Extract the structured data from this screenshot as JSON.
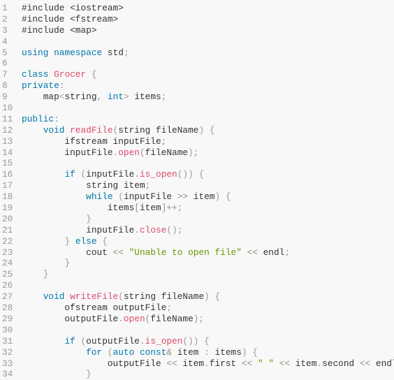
{
  "editor": {
    "language": "cpp",
    "colors": {
      "background": "#f8f8f8",
      "line_number": "#999999",
      "text": "#333333",
      "keyword": "#0077aa",
      "function": "#dd4a68",
      "string": "#669900",
      "punctuation": "#999999"
    },
    "lines": [
      {
        "n": "1",
        "tokens": [
          [
            "plain",
            "#include <iostream>"
          ]
        ]
      },
      {
        "n": "2",
        "tokens": [
          [
            "plain",
            "#include <fstream>"
          ]
        ]
      },
      {
        "n": "3",
        "tokens": [
          [
            "plain",
            "#include <map>"
          ]
        ]
      },
      {
        "n": "4",
        "tokens": []
      },
      {
        "n": "5",
        "tokens": [
          [
            "kw",
            "using"
          ],
          [
            "plain",
            " "
          ],
          [
            "kw",
            "namespace"
          ],
          [
            "plain",
            " std"
          ],
          [
            "punc",
            ";"
          ]
        ]
      },
      {
        "n": "6",
        "tokens": []
      },
      {
        "n": "7",
        "tokens": [
          [
            "kw",
            "class"
          ],
          [
            "plain",
            " "
          ],
          [
            "cls",
            "Grocer"
          ],
          [
            "plain",
            " "
          ],
          [
            "punc",
            "{"
          ]
        ]
      },
      {
        "n": "8",
        "tokens": [
          [
            "kw",
            "private"
          ],
          [
            "punc",
            ":"
          ]
        ]
      },
      {
        "n": "9",
        "tokens": [
          [
            "plain",
            "    map"
          ],
          [
            "punc",
            "<"
          ],
          [
            "plain",
            "string"
          ],
          [
            "punc",
            ","
          ],
          [
            "plain",
            " "
          ],
          [
            "kw",
            "int"
          ],
          [
            "punc",
            ">"
          ],
          [
            "plain",
            " items"
          ],
          [
            "punc",
            ";"
          ]
        ]
      },
      {
        "n": "10",
        "tokens": []
      },
      {
        "n": "11",
        "tokens": [
          [
            "kw",
            "public"
          ],
          [
            "punc",
            ":"
          ]
        ]
      },
      {
        "n": "12",
        "tokens": [
          [
            "plain",
            "    "
          ],
          [
            "kw",
            "void"
          ],
          [
            "plain",
            " "
          ],
          [
            "fn",
            "readFile"
          ],
          [
            "punc",
            "("
          ],
          [
            "plain",
            "string fileName"
          ],
          [
            "punc",
            ")"
          ],
          [
            "plain",
            " "
          ],
          [
            "punc",
            "{"
          ]
        ]
      },
      {
        "n": "13",
        "tokens": [
          [
            "plain",
            "        ifstream inputFile"
          ],
          [
            "punc",
            ";"
          ]
        ]
      },
      {
        "n": "14",
        "tokens": [
          [
            "plain",
            "        inputFile"
          ],
          [
            "punc",
            "."
          ],
          [
            "fn",
            "open"
          ],
          [
            "punc",
            "("
          ],
          [
            "plain",
            "fileName"
          ],
          [
            "punc",
            ")"
          ],
          [
            "punc",
            ";"
          ]
        ]
      },
      {
        "n": "15",
        "tokens": []
      },
      {
        "n": "16",
        "tokens": [
          [
            "plain",
            "        "
          ],
          [
            "kw",
            "if"
          ],
          [
            "plain",
            " "
          ],
          [
            "punc",
            "("
          ],
          [
            "plain",
            "inputFile"
          ],
          [
            "punc",
            "."
          ],
          [
            "fn",
            "is_open"
          ],
          [
            "punc",
            "("
          ],
          [
            "punc",
            ")"
          ],
          [
            "punc",
            ")"
          ],
          [
            "plain",
            " "
          ],
          [
            "punc",
            "{"
          ]
        ]
      },
      {
        "n": "17",
        "tokens": [
          [
            "plain",
            "            string item"
          ],
          [
            "punc",
            ";"
          ]
        ]
      },
      {
        "n": "18",
        "tokens": [
          [
            "plain",
            "            "
          ],
          [
            "kw",
            "while"
          ],
          [
            "plain",
            " "
          ],
          [
            "punc",
            "("
          ],
          [
            "plain",
            "inputFile "
          ],
          [
            "op",
            ">>"
          ],
          [
            "plain",
            " item"
          ],
          [
            "punc",
            ")"
          ],
          [
            "plain",
            " "
          ],
          [
            "punc",
            "{"
          ]
        ]
      },
      {
        "n": "19",
        "tokens": [
          [
            "plain",
            "                items"
          ],
          [
            "punc",
            "["
          ],
          [
            "plain",
            "item"
          ],
          [
            "punc",
            "]"
          ],
          [
            "op",
            "++"
          ],
          [
            "punc",
            ";"
          ]
        ]
      },
      {
        "n": "20",
        "tokens": [
          [
            "plain",
            "            "
          ],
          [
            "punc",
            "}"
          ]
        ]
      },
      {
        "n": "21",
        "tokens": [
          [
            "plain",
            "            inputFile"
          ],
          [
            "punc",
            "."
          ],
          [
            "fn",
            "close"
          ],
          [
            "punc",
            "("
          ],
          [
            "punc",
            ")"
          ],
          [
            "punc",
            ";"
          ]
        ]
      },
      {
        "n": "22",
        "tokens": [
          [
            "plain",
            "        "
          ],
          [
            "punc",
            "}"
          ],
          [
            "plain",
            " "
          ],
          [
            "kw",
            "else"
          ],
          [
            "plain",
            " "
          ],
          [
            "punc",
            "{"
          ]
        ]
      },
      {
        "n": "23",
        "tokens": [
          [
            "plain",
            "            cout "
          ],
          [
            "op",
            "<<"
          ],
          [
            "plain",
            " "
          ],
          [
            "str",
            "\"Unable to open file\""
          ],
          [
            "plain",
            " "
          ],
          [
            "op",
            "<<"
          ],
          [
            "plain",
            " endl"
          ],
          [
            "punc",
            ";"
          ]
        ]
      },
      {
        "n": "24",
        "tokens": [
          [
            "plain",
            "        "
          ],
          [
            "punc",
            "}"
          ]
        ]
      },
      {
        "n": "25",
        "tokens": [
          [
            "plain",
            "    "
          ],
          [
            "punc",
            "}"
          ]
        ]
      },
      {
        "n": "26",
        "tokens": []
      },
      {
        "n": "27",
        "tokens": [
          [
            "plain",
            "    "
          ],
          [
            "kw",
            "void"
          ],
          [
            "plain",
            " "
          ],
          [
            "fn",
            "writeFile"
          ],
          [
            "punc",
            "("
          ],
          [
            "plain",
            "string fileName"
          ],
          [
            "punc",
            ")"
          ],
          [
            "plain",
            " "
          ],
          [
            "punc",
            "{"
          ]
        ]
      },
      {
        "n": "28",
        "tokens": [
          [
            "plain",
            "        ofstream outputFile"
          ],
          [
            "punc",
            ";"
          ]
        ]
      },
      {
        "n": "29",
        "tokens": [
          [
            "plain",
            "        outputFile"
          ],
          [
            "punc",
            "."
          ],
          [
            "fn",
            "open"
          ],
          [
            "punc",
            "("
          ],
          [
            "plain",
            "fileName"
          ],
          [
            "punc",
            ")"
          ],
          [
            "punc",
            ";"
          ]
        ]
      },
      {
        "n": "30",
        "tokens": []
      },
      {
        "n": "31",
        "tokens": [
          [
            "plain",
            "        "
          ],
          [
            "kw",
            "if"
          ],
          [
            "plain",
            " "
          ],
          [
            "punc",
            "("
          ],
          [
            "plain",
            "outputFile"
          ],
          [
            "punc",
            "."
          ],
          [
            "fn",
            "is_open"
          ],
          [
            "punc",
            "("
          ],
          [
            "punc",
            ")"
          ],
          [
            "punc",
            ")"
          ],
          [
            "plain",
            " "
          ],
          [
            "punc",
            "{"
          ]
        ]
      },
      {
        "n": "32",
        "tokens": [
          [
            "plain",
            "            "
          ],
          [
            "kw",
            "for"
          ],
          [
            "plain",
            " "
          ],
          [
            "punc",
            "("
          ],
          [
            "kw",
            "auto"
          ],
          [
            "plain",
            " "
          ],
          [
            "kw",
            "const"
          ],
          [
            "op",
            "&"
          ],
          [
            "plain",
            " item "
          ],
          [
            "op",
            ":"
          ],
          [
            "plain",
            " items"
          ],
          [
            "punc",
            ")"
          ],
          [
            "plain",
            " "
          ],
          [
            "punc",
            "{"
          ]
        ]
      },
      {
        "n": "33",
        "tokens": [
          [
            "plain",
            "                outputFile "
          ],
          [
            "op",
            "<<"
          ],
          [
            "plain",
            " item"
          ],
          [
            "punc",
            "."
          ],
          [
            "plain",
            "first "
          ],
          [
            "op",
            "<<"
          ],
          [
            "plain",
            " "
          ],
          [
            "str",
            "\" \""
          ],
          [
            "plain",
            " "
          ],
          [
            "op",
            "<<"
          ],
          [
            "plain",
            " item"
          ],
          [
            "punc",
            "."
          ],
          [
            "plain",
            "second "
          ],
          [
            "op",
            "<<"
          ],
          [
            "plain",
            " endl"
          ],
          [
            "punc",
            ";"
          ]
        ]
      },
      {
        "n": "34",
        "tokens": [
          [
            "plain",
            "            "
          ],
          [
            "punc",
            "}"
          ]
        ]
      }
    ]
  }
}
